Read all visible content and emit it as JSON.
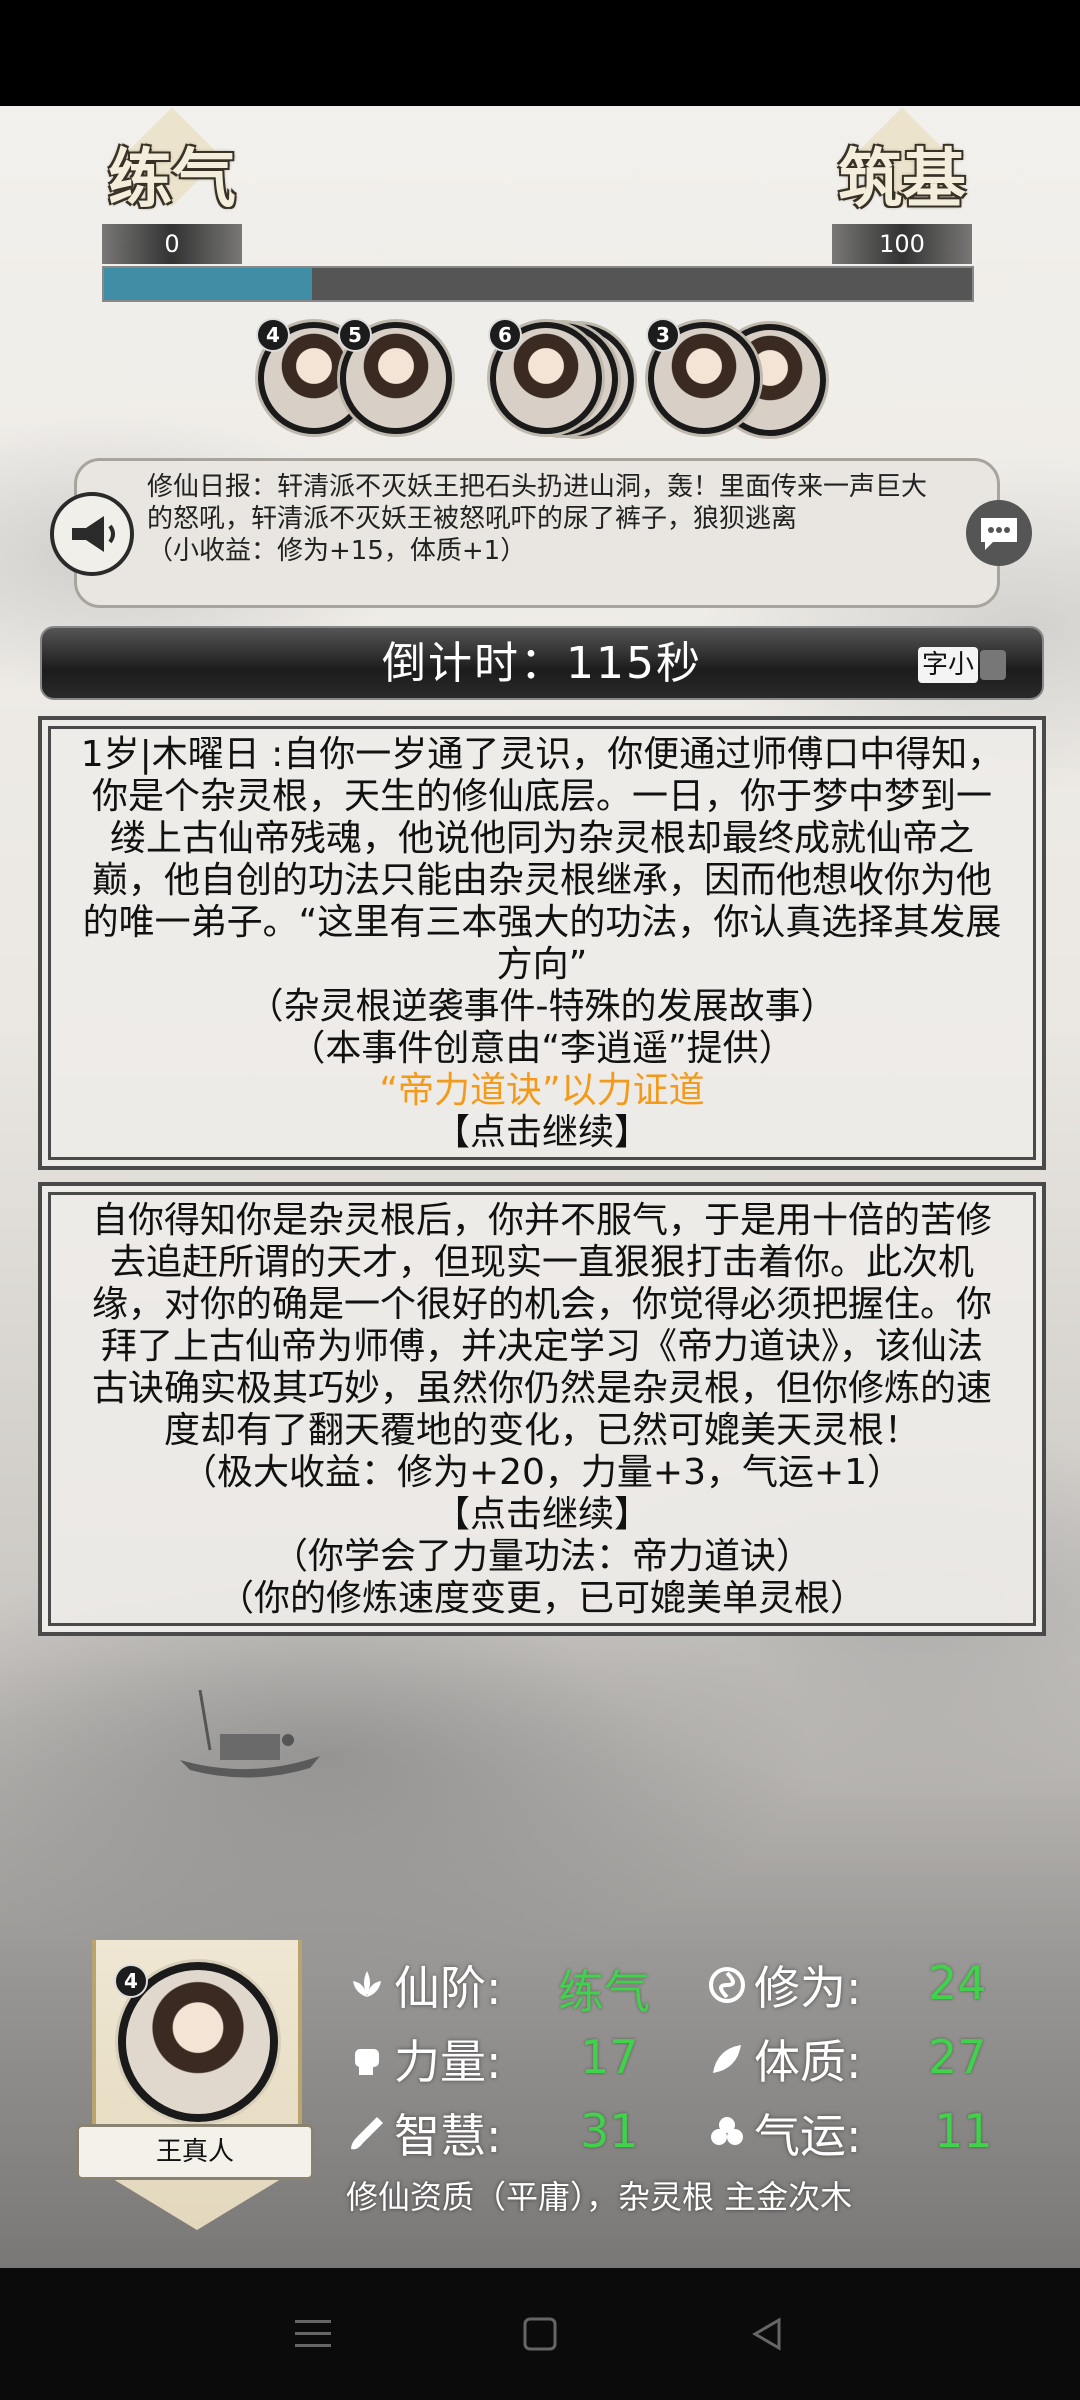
{
  "realm": {
    "current": {
      "name": "练气",
      "value": "0"
    },
    "next": {
      "name": "筑基",
      "value": "100"
    },
    "progress": 0.24
  },
  "avatars": [
    "4",
    "5",
    "6",
    "3"
  ],
  "news": {
    "line1": "修仙日报：轩清派不灭妖王把石头扔进山洞，轰！里面传来一声巨大",
    "line2": "的怒吼，轩清派不灭妖王被怒吼吓的尿了裤子，狼狈逃离",
    "line3": "（小收益：修为+15，体质+1）"
  },
  "countdown": {
    "text": "倒计时：115秒",
    "font_toggle": "字小"
  },
  "event1": {
    "lines": [
      "1岁|木曜日 :自你一岁通了灵识，你便通过师傅口中得知，",
      "你是个杂灵根，天生的修仙底层。一日，你于梦中梦到一",
      "缕上古仙帝残魂，他说他同为杂灵根却最终成就仙帝之",
      "巅，他自创的功法只能由杂灵根继承，因而他想收你为他",
      "的唯一弟子。“这里有三本强大的功法，你认真选择其发展",
      "方向”",
      "（杂灵根逆袭事件-特殊的发展故事）",
      "（本事件创意由“李逍遥”提供）"
    ],
    "highlight": "“帝力道诀”以力证道",
    "continue": "【点击继续】"
  },
  "event2": {
    "lines": [
      "自你得知你是杂灵根后，你并不服气，于是用十倍的苦修",
      "去追赶所谓的天才，但现实一直狠狠打击着你。此次机",
      "缘，对你的确是一个很好的机会，你觉得必须把握住。你",
      "拜了上古仙帝为师傅，并决定学习《帝力道诀》，该仙法",
      "古诀确实极其巧妙，虽然你仍然是杂灵根，但你修炼的速",
      "度却有了翻天覆地的变化，已然可媲美天灵根！",
      "（极大收益：修为+20，力量+3，气运+1）"
    ],
    "continue": "【点击继续】",
    "after": [
      "（你学会了力量功法：帝力道诀）",
      "（你的修炼速度变更，已可媲美单灵根）"
    ]
  },
  "character": {
    "level": "4",
    "name": "王真人",
    "stats": {
      "rank": {
        "label": "仙阶:",
        "value": "练气"
      },
      "cultivation": {
        "label": "修为:",
        "value": "24"
      },
      "strength": {
        "label": "力量:",
        "value": "17"
      },
      "physique": {
        "label": "体质:",
        "value": "27"
      },
      "wisdom": {
        "label": "智慧:",
        "value": "31"
      },
      "luck": {
        "label": "气运:",
        "value": "11"
      }
    },
    "aptitude": "修仙资质（平庸），杂灵根 主金次木"
  },
  "colors": {
    "accent_green": "#3fd24a",
    "highlight_orange": "#f39a1a",
    "progress_blue": "#3f8ea6"
  }
}
